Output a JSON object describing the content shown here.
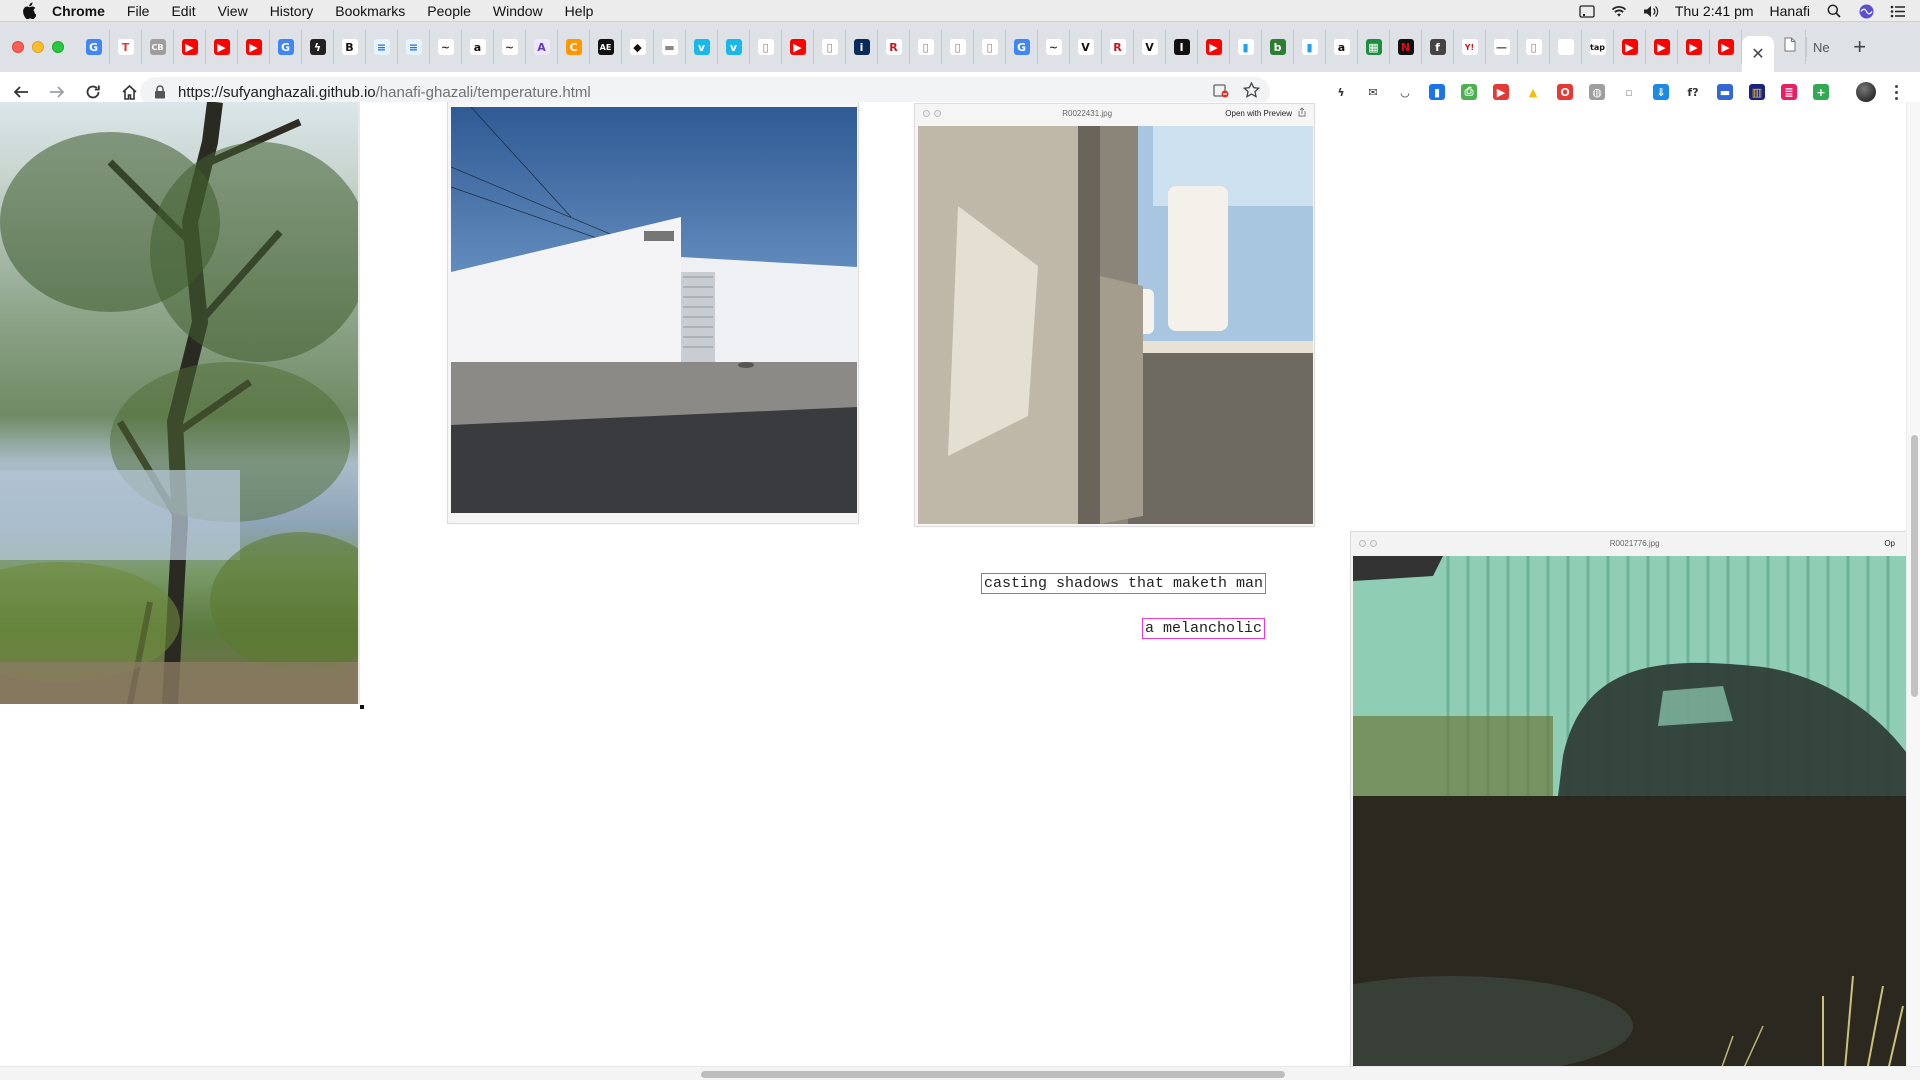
{
  "menubar": {
    "app_name": "Chrome",
    "menus": [
      "File",
      "Edit",
      "View",
      "History",
      "Bookmarks",
      "People",
      "Window",
      "Help"
    ],
    "clock": "Thu 2:41 pm",
    "user": "Hanafi"
  },
  "tabs": {
    "last_tab_label": "Ne",
    "new_tab_glyph": "+",
    "close_glyph": "✕",
    "pinned": [
      {
        "icon": "google-icon",
        "glyph": "G",
        "color": "#4285f4",
        "text_color": "#ffffff"
      },
      {
        "icon": "t-icon",
        "glyph": "T",
        "color": "#ffffff",
        "text_color": "#e03c31"
      },
      {
        "icon": "cb-icon",
        "glyph": "CB",
        "color": "#9e9e9e",
        "text_color": "#ffffff"
      },
      {
        "icon": "youtube-icon",
        "glyph": "▶",
        "color": "#ff0000",
        "text_color": "#ffffff"
      },
      {
        "icon": "youtube-icon",
        "glyph": "▶",
        "color": "#ff0000",
        "text_color": "#ffffff"
      },
      {
        "icon": "youtube-icon",
        "glyph": "▶",
        "color": "#ff0000",
        "text_color": "#ffffff"
      },
      {
        "icon": "google-icon",
        "glyph": "G",
        "color": "#4285f4",
        "text_color": "#ffffff"
      },
      {
        "icon": "bolt-icon",
        "glyph": "ϟ",
        "color": "#222222",
        "text_color": "#ffffff"
      },
      {
        "icon": "bold-b-icon",
        "glyph": "B",
        "color": "#ffffff",
        "text_color": "#111111"
      },
      {
        "icon": "note-icon",
        "glyph": "≡",
        "color": "#e6f4ff",
        "text_color": "#1a73e8"
      },
      {
        "icon": "note-icon",
        "glyph": "≡",
        "color": "#e6f4ff",
        "text_color": "#1a73e8"
      },
      {
        "icon": "bandcamp-icon",
        "glyph": "~",
        "color": "#ffffff",
        "text_color": "#333333"
      },
      {
        "icon": "amazon-icon",
        "glyph": "a",
        "color": "#ffffff",
        "text_color": "#111111"
      },
      {
        "icon": "bandcamp-icon",
        "glyph": "~",
        "color": "#ffffff",
        "text_color": "#333333"
      },
      {
        "icon": "a-box-icon",
        "glyph": "A",
        "color": "#ede7ff",
        "text_color": "#673ab7"
      },
      {
        "icon": "c-circle-icon",
        "glyph": "C",
        "color": "#ff9800",
        "text_color": "#ffffff"
      },
      {
        "icon": "ae-icon",
        "glyph": "AE",
        "color": "#111111",
        "text_color": "#ffffff"
      },
      {
        "icon": "diamond-icon",
        "glyph": "◆",
        "color": "#ffffff",
        "text_color": "#111111"
      },
      {
        "icon": "strip-icon",
        "glyph": "▬",
        "color": "#ffffff",
        "text_color": "#888888"
      },
      {
        "icon": "vimeo-icon",
        "glyph": "v",
        "color": "#1ab7ea",
        "text_color": "#ffffff"
      },
      {
        "icon": "vimeo-icon",
        "glyph": "v",
        "color": "#1ab7ea",
        "text_color": "#ffffff"
      },
      {
        "icon": "page-icon",
        "glyph": "▯",
        "color": "#ffffff",
        "text_color": "#777777"
      },
      {
        "icon": "youtube-icon",
        "glyph": "▶",
        "color": "#ff0000",
        "text_color": "#ffffff"
      },
      {
        "icon": "page-icon",
        "glyph": "▯",
        "color": "#ffffff",
        "text_color": "#777777"
      },
      {
        "icon": "info-icon",
        "glyph": "i",
        "color": "#0b2a5c",
        "text_color": "#ffffff"
      },
      {
        "icon": "r-icon",
        "glyph": "R",
        "color": "#ffffff",
        "text_color": "#c4161c"
      },
      {
        "icon": "page-icon",
        "glyph": "▯",
        "color": "#ffffff",
        "text_color": "#777777"
      },
      {
        "icon": "page-icon",
        "glyph": "▯",
        "color": "#ffffff",
        "text_color": "#777777"
      },
      {
        "icon": "page-icon",
        "glyph": "▯",
        "color": "#ffffff",
        "text_color": "#777777"
      },
      {
        "icon": "google-icon",
        "glyph": "G",
        "color": "#4285f4",
        "text_color": "#ffffff"
      },
      {
        "icon": "bandcamp-icon",
        "glyph": "~",
        "color": "#ffffff",
        "text_color": "#333333"
      },
      {
        "icon": "v-icon",
        "glyph": "V",
        "color": "#ffffff",
        "text_color": "#111111"
      },
      {
        "icon": "r-icon",
        "glyph": "R",
        "color": "#ffffff",
        "text_color": "#c4161c"
      },
      {
        "icon": "v-icon",
        "glyph": "V",
        "color": "#ffffff",
        "text_color": "#111111"
      },
      {
        "icon": "i-box-icon",
        "glyph": "I",
        "color": "#111111",
        "text_color": "#ffffff"
      },
      {
        "icon": "youtube-icon",
        "glyph": "▶",
        "color": "#ff0000",
        "text_color": "#ffffff"
      },
      {
        "icon": "bookmark-icon",
        "glyph": "▮",
        "color": "#ffffff",
        "text_color": "#1da1f2"
      },
      {
        "icon": "b-box-icon",
        "glyph": "b",
        "color": "#2e7d32",
        "text_color": "#ffffff"
      },
      {
        "icon": "bookmark-icon",
        "glyph": "▮",
        "color": "#ffffff",
        "text_color": "#1da1f2"
      },
      {
        "icon": "amazon-icon",
        "glyph": "a",
        "color": "#ffffff",
        "text_color": "#111111"
      },
      {
        "icon": "sheet-icon",
        "glyph": "▦",
        "color": "#1e8e3e",
        "text_color": "#ffffff"
      },
      {
        "icon": "netflix-icon",
        "glyph": "N",
        "color": "#111111",
        "text_color": "#e50914"
      },
      {
        "icon": "f-box-icon",
        "glyph": "f",
        "color": "#444444",
        "text_color": "#ffffff"
      },
      {
        "icon": "yahoo-icon",
        "glyph": "Y!",
        "color": "#ffffff",
        "text_color": "#c4161c"
      },
      {
        "icon": "dash-icon",
        "glyph": "—",
        "color": "#ffffff",
        "text_color": "#555555"
      },
      {
        "icon": "page-icon",
        "glyph": "▯",
        "color": "#ffffff",
        "text_color": "#777777"
      },
      {
        "icon": "blank-icon",
        "glyph": "",
        "color": "#ffffff",
        "text_color": "#ffffff"
      },
      {
        "icon": "tap-icon",
        "glyph": "tap",
        "color": "#ffffff",
        "text_color": "#111111"
      },
      {
        "icon": "youtube-icon",
        "glyph": "▶",
        "color": "#ff0000",
        "text_color": "#ffffff"
      },
      {
        "icon": "youtube-icon",
        "glyph": "▶",
        "color": "#ff0000",
        "text_color": "#ffffff"
      },
      {
        "icon": "youtube-icon",
        "glyph": "▶",
        "color": "#ff0000",
        "text_color": "#ffffff"
      },
      {
        "icon": "youtube-icon",
        "glyph": "▶",
        "color": "#ff0000",
        "text_color": "#ffffff"
      }
    ]
  },
  "toolbar": {
    "url_host": "https://sufyanghazali.github.io",
    "url_path": "/hanafi-ghazali/temperature.html",
    "extensions": [
      {
        "icon": "bolt-icon",
        "glyph": "ϟ",
        "color": "#ffffff",
        "text_color": "#333333"
      },
      {
        "icon": "mail-icon",
        "glyph": "✉",
        "color": "#ffffff",
        "text_color": "#333333"
      },
      {
        "icon": "pocket-icon",
        "glyph": "◡",
        "color": "#ffffff",
        "text_color": "#333333"
      },
      {
        "icon": "book-icon",
        "glyph": "▮",
        "color": "#1a73e8",
        "text_color": "#ffffff"
      },
      {
        "icon": "printer-icon",
        "glyph": "⎙",
        "color": "#4caf50",
        "text_color": "#ffffff"
      },
      {
        "icon": "record-icon",
        "glyph": "▶",
        "color": "#e53935",
        "text_color": "#ffffff"
      },
      {
        "icon": "drive-icon",
        "glyph": "▲",
        "color": "#ffffff",
        "text_color": "#fbbc04"
      },
      {
        "icon": "opera-icon",
        "glyph": "O",
        "color": "#e53935",
        "text_color": "#ffffff"
      },
      {
        "icon": "globe-icon",
        "glyph": "◍",
        "color": "#9e9e9e",
        "text_color": "#ffffff"
      },
      {
        "icon": "grey-icon",
        "glyph": "▫",
        "color": "#ffffff",
        "text_color": "#999999"
      },
      {
        "icon": "download-icon",
        "glyph": "⇓",
        "color": "#1e88e5",
        "text_color": "#ffffff"
      },
      {
        "icon": "font-icon",
        "glyph": "f?",
        "color": "#ffffff",
        "text_color": "#333333"
      },
      {
        "icon": "bookmark-blue-icon",
        "glyph": "▬",
        "color": "#3367d6",
        "text_color": "#ffffff"
      },
      {
        "icon": "chart-icon",
        "glyph": "▥",
        "color": "#1a237e",
        "text_color": "#ffca28"
      },
      {
        "icon": "list-icon",
        "glyph": "≣",
        "color": "#e91e63",
        "text_color": "#ffffff"
      },
      {
        "icon": "plus-green-icon",
        "glyph": "+",
        "color": "#34a853",
        "text_color": "#ffffff"
      }
    ]
  },
  "page": {
    "photo_top_center": {
      "filename": "R0022431.jpg",
      "open_with": "Open with Preview"
    },
    "photo_right": {
      "filename": "R0021776.jpg",
      "open_with": "Op"
    },
    "poem": {
      "line1": "casting shadows that maketh man",
      "line2": "a melancholic"
    }
  }
}
